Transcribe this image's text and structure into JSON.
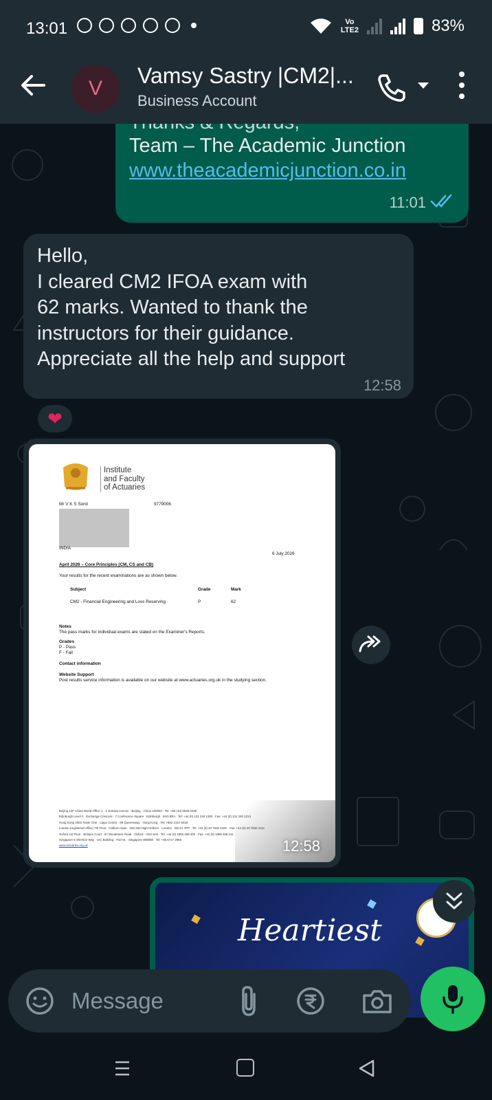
{
  "status_bar": {
    "time": "13:01",
    "network_top": "Vo",
    "network_bottom": "LTE2",
    "battery": "83%"
  },
  "header": {
    "back_icon": "arrow-left-icon",
    "avatar_letter": "V",
    "contact_name": "Vamsy Sastry |CM2|...",
    "subtitle": "Business Account",
    "call_icon": "phone-icon",
    "menu_icon": "more-vert-icon"
  },
  "messages": {
    "outgoing": {
      "line1": "Thanks & Regards,",
      "line2": "Team – The Academic Junction",
      "link": "www.theacademicjunction.co.in",
      "time": "11:01"
    },
    "incoming": {
      "lines": [
        "Hello,",
        "I cleared CM2 IFOA exam with",
        "62 marks. Wanted to thank the",
        "instructors for their guidance.",
        "Appreciate all the help and support"
      ],
      "time": "12:58",
      "reaction": "❤"
    },
    "image": {
      "time": "12:58",
      "document": {
        "org_lines": [
          "Institute",
          "and Faculty",
          "of Actuaries"
        ],
        "recipient": "Mr V K S Sonti",
        "ref_no": "9779006",
        "country": "INDIA",
        "date": "6 July 2026",
        "session_title": "April 2026 – Core Principles (CM, CS and CB)",
        "intro": "Your results for the recent examinations are as shown below.",
        "col_subject": "Subject",
        "col_grade": "Grade",
        "col_mark": "Mark",
        "subject": "CM2 - Financial Engineering and Loss Reserving",
        "grade": "P",
        "mark": "62",
        "notes_head": "Notes",
        "notes_text": "The pass marks for individual exams are stated on the Examiner's Reports.",
        "grades_head": "Grades",
        "grade_p": "P - Pass",
        "grade_f": "F - Fail",
        "contact_head": "Contact information",
        "website_head": "Website Support",
        "website_text": "Post results service information is available on our website at www.actuaries.org.uk in the studying section.",
        "footer": [
          "Beijing 14F China World Office 1 · 1 Jianwai Avenue · Beijing · China 100004 · Tel: +86 (10) 6535 0248",
          "Edinburgh Level 2 · Exchange Crescent · 7 Conference Square · Edinburgh · EH3 8RA · Tel: +44 (0) 131 240 1300 · Fax: +44 (0) 131 240 1313",
          "Hong Kong 1803 Tower One · Lippo Centre · 89 Queensway · Hong Kong · Tel: +852 2147 9418",
          "London (registered office) 7th Floor · Holborn Gate · 326-330 High Holborn · London · WC1V 7PP · Tel: +44 (0) 20 7632 2100 · Fax: +44 (0) 20 7632 2111",
          "Oxford 1st Floor · Belsyre Court · 57 Woodstock Road · Oxford · OX2 6HJ · Tel: +44 (0) 1865 268 200 · Fax: +44 (0) 1865 268 211",
          "Singapore 5 Shenton Way · UIC Building · #10-01 · Singapore 068808 · Tel: +65 6717 2955",
          "www.actuaries.org.uk"
        ]
      }
    },
    "card": {
      "script_text": "Heartiest"
    }
  },
  "input_bar": {
    "placeholder": "Message",
    "emoji_icon": "sticker-smile-icon",
    "attach_icon": "paperclip-icon",
    "payment_icon": "rupee-icon",
    "camera_icon": "camera-icon",
    "mic_icon": "mic-icon"
  },
  "colors": {
    "header_bg": "#1f2c34",
    "chat_bg": "#0b141a",
    "outgoing_bubble": "#005c4b",
    "incoming_bubble": "#1f2c34",
    "link": "#53bdeb",
    "read_ticks": "#53bdeb",
    "mic_button": "#21c063"
  }
}
